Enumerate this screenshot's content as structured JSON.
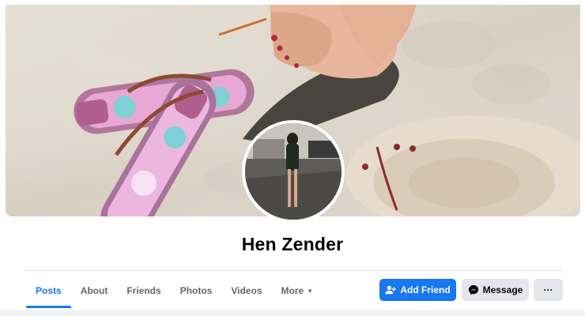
{
  "profile": {
    "name": "Hen Zender"
  },
  "tabs": [
    {
      "label": "Posts",
      "active": true
    },
    {
      "label": "About",
      "active": false
    },
    {
      "label": "Friends",
      "active": false
    },
    {
      "label": "Photos",
      "active": false
    },
    {
      "label": "Videos",
      "active": false
    },
    {
      "label": "More",
      "active": false
    }
  ],
  "actions": {
    "add_friend": "Add Friend",
    "message": "Message",
    "more": "···"
  },
  "icons": {
    "add_friend": "add-person-icon",
    "message": "messenger-icon",
    "more_tab": "caret-down-icon"
  },
  "colors": {
    "accent": "#1877f2",
    "secondary_button": "#e4e6eb",
    "text_secondary": "#65676b"
  }
}
